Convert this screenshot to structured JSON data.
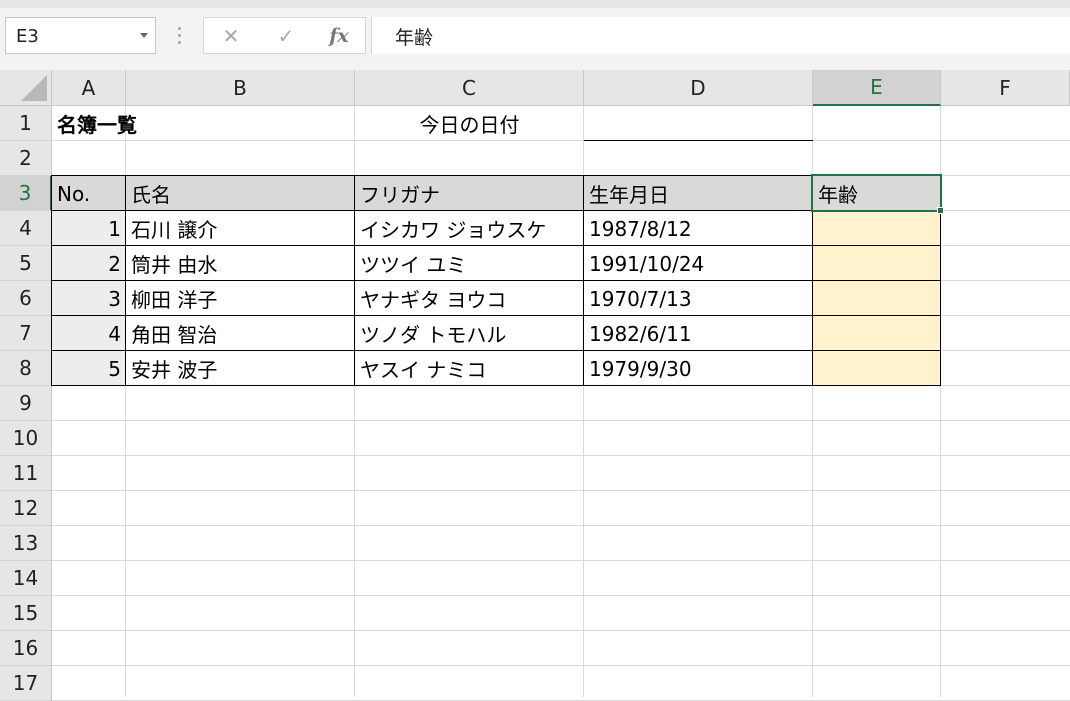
{
  "formula_bar": {
    "name_box": "E3",
    "formula": "年齢",
    "cancel_symbol": "✕",
    "enter_symbol": "✓",
    "fx_label": "fx"
  },
  "columns": [
    "A",
    "B",
    "C",
    "D",
    "E",
    "F"
  ],
  "selected_column": "E",
  "rows": [
    "1",
    "2",
    "3",
    "4",
    "5",
    "6",
    "7",
    "8",
    "9",
    "10",
    "11",
    "12",
    "13",
    "14",
    "15",
    "16",
    "17"
  ],
  "selected_row": "3",
  "sheet": {
    "title": "名簿一覧",
    "date_label": "今日の日付",
    "date_value": "",
    "headers": {
      "no": "No.",
      "name": "氏名",
      "kana": "フリガナ",
      "birth": "生年月日",
      "age": "年齢"
    },
    "records": [
      {
        "no": "1",
        "name": "石川 譲介",
        "kana": "イシカワ ジョウスケ",
        "birth": "1987/8/12",
        "age": ""
      },
      {
        "no": "2",
        "name": "筒井 由水",
        "kana": "ツツイ ユミ",
        "birth": "1991/10/24",
        "age": ""
      },
      {
        "no": "3",
        "name": "柳田 洋子",
        "kana": "ヤナギタ ヨウコ",
        "birth": "1970/7/13",
        "age": ""
      },
      {
        "no": "4",
        "name": "角田 智治",
        "kana": "ツノダ トモハル",
        "birth": "1982/6/11",
        "age": ""
      },
      {
        "no": "5",
        "name": "安井 波子",
        "kana": "ヤスイ ナミコ",
        "birth": "1979/9/30",
        "age": ""
      }
    ]
  },
  "colors": {
    "header_fill": "#d9d9d9",
    "no_fill": "#ededed",
    "age_fill": "#fff2cc",
    "selection": "#217346"
  },
  "icons": {
    "name_box_dropdown": "chevron-down-icon",
    "cancel": "close-icon",
    "enter": "check-icon",
    "function": "fx-icon"
  }
}
